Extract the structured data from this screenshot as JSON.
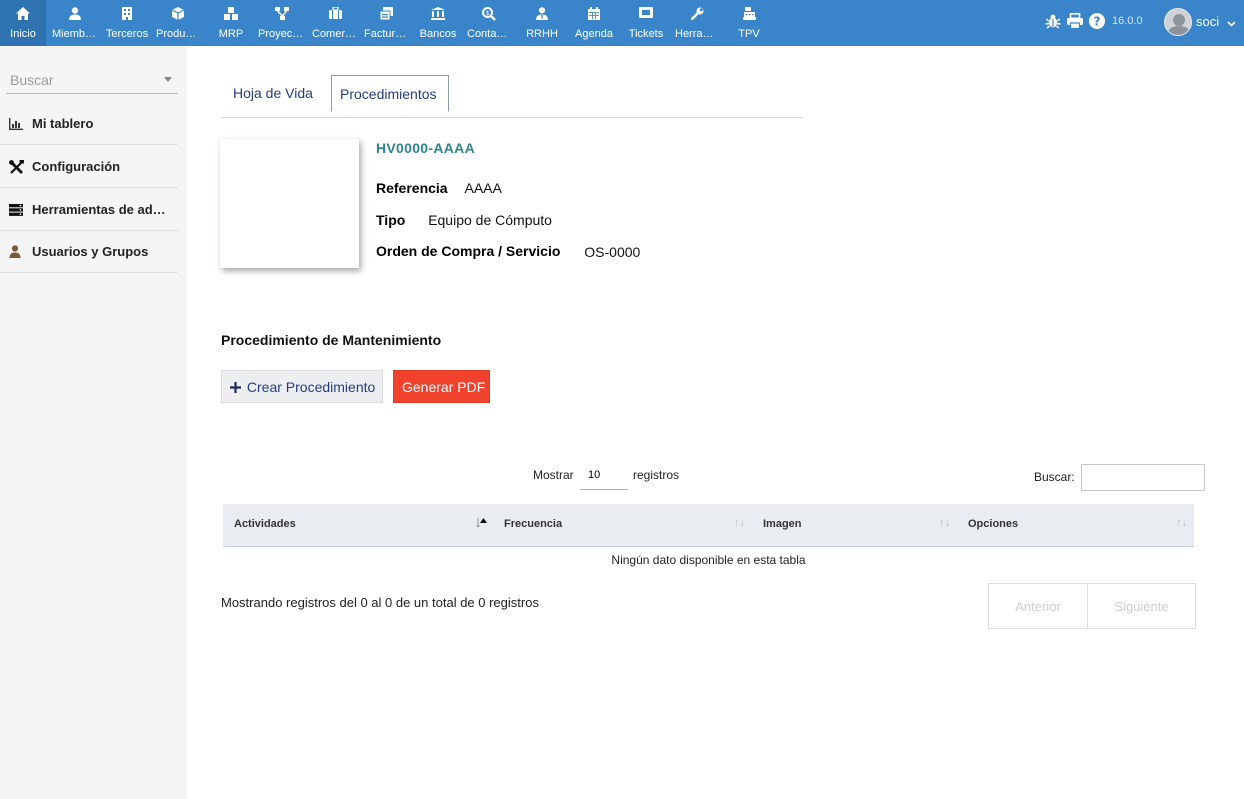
{
  "nav": [
    {
      "label": "Inicio",
      "icon": "home-icon"
    },
    {
      "label": "Miembros",
      "icon": "member-icon"
    },
    {
      "label": "Terceros",
      "icon": "building-icon"
    },
    {
      "label": "Productos",
      "icon": "cube-icon"
    },
    {
      "label": "MRP",
      "icon": "cubes-icon"
    },
    {
      "label": "Proyectos",
      "icon": "sitemap-icon"
    },
    {
      "label": "Comercial",
      "icon": "suitcase-icon"
    },
    {
      "label": "Facturación",
      "icon": "invoice-icon"
    },
    {
      "label": "Bancos",
      "icon": "bank-icon"
    },
    {
      "label": "Contabilidad",
      "icon": "search-dollar-icon"
    },
    {
      "label": "RRHH",
      "icon": "user-tie-icon"
    },
    {
      "label": "Agenda",
      "icon": "calendar-icon"
    },
    {
      "label": "Tickets",
      "icon": "ticket-icon"
    },
    {
      "label": "Herramientas",
      "icon": "wrench-icon"
    },
    {
      "label": "TPV",
      "icon": "cash-register-icon"
    }
  ],
  "top_right": {
    "version": "16.0.0",
    "user": "soci"
  },
  "sidebar": {
    "search_placeholder": "Buscar",
    "items": [
      {
        "label": "Mi tablero",
        "icon": "chart-bar-icon"
      },
      {
        "label": "Configuración",
        "icon": "tools-icon"
      },
      {
        "label": "Herramientas de administración",
        "icon": "server-icon"
      },
      {
        "label": "Usuarios y Grupos",
        "icon": "user-icon"
      }
    ]
  },
  "tabs": [
    "Hoja de Vida",
    "Procedimientos"
  ],
  "asset": {
    "ref_code": "HV0000-AAAA",
    "referencia_label": "Referencia",
    "referencia_value": "AAAA",
    "tipo_label": "Tipo",
    "tipo_value": "Equipo de Cómputo",
    "orden_label": "Orden de Compra / Servicio",
    "orden_value": "OS-0000"
  },
  "section": {
    "title": "Procedimiento de Mantenimiento",
    "create_label": "Crear Procedimiento",
    "pdf_label": "Generar PDF"
  },
  "table": {
    "show_label": "Mostrar",
    "page_length": "10",
    "records_label": "registros",
    "search_label": "Buscar:",
    "columns": [
      "Actividades",
      "Frecuencia",
      "Imagen",
      "Opciones"
    ],
    "empty": "Ningún dato disponible en esta tabla",
    "info": "Mostrando registros del 0 al 0 de un total de 0 registros",
    "prev": "Anterior",
    "next": "Siguiente"
  }
}
